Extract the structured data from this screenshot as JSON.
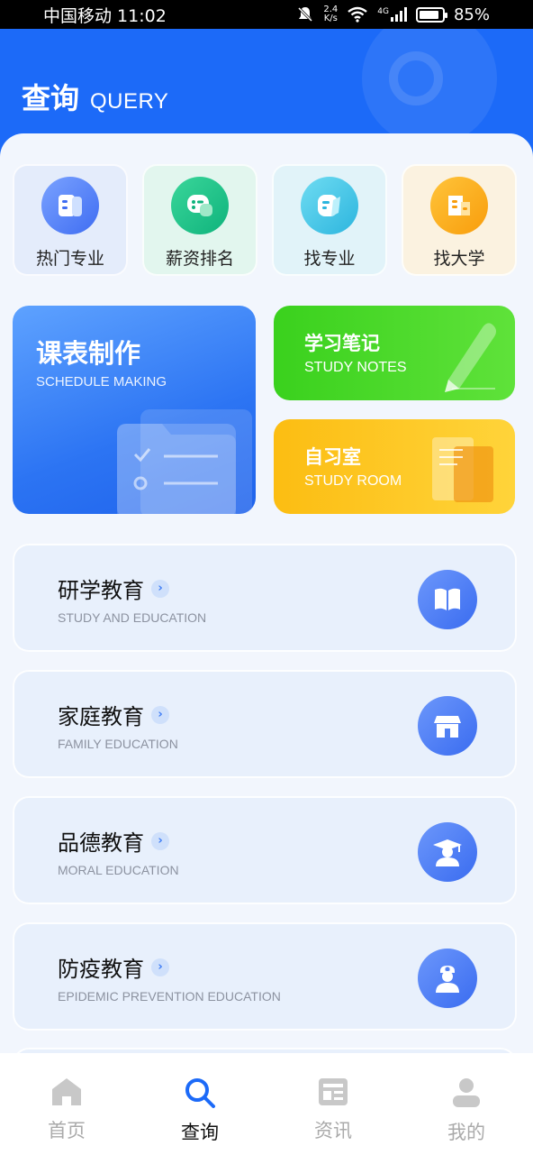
{
  "status_bar": {
    "carrier_time": "中国移动 11:02",
    "speed_value": "2.4",
    "speed_unit": "K/s",
    "network": "4G",
    "battery": "85%"
  },
  "header": {
    "title_zh": "查询",
    "title_en": "QUERY"
  },
  "quick_entries": [
    {
      "label": "热门专业",
      "icon": "book-stack-icon",
      "color": "#3f6df2"
    },
    {
      "label": "薪资排名",
      "icon": "chat-bubble-icon",
      "color": "#0fb37c"
    },
    {
      "label": "找专业",
      "icon": "note-icon",
      "color": "#2cb5de"
    },
    {
      "label": "找大学",
      "icon": "building-icon",
      "color": "#f89d0c"
    }
  ],
  "feature_cards": {
    "schedule": {
      "title": "课表制作",
      "subtitle": "SCHEDULE MAKING"
    },
    "notes": {
      "title": "学习笔记",
      "subtitle": "STUDY NOTES"
    },
    "room": {
      "title": "自习室",
      "subtitle": "STUDY ROOM"
    }
  },
  "education_list": [
    {
      "title": "研学教育",
      "subtitle": "STUDY AND EDUCATION",
      "icon": "open-book-icon"
    },
    {
      "title": "家庭教育",
      "subtitle": "FAMILY EDUCATION",
      "icon": "house-icon"
    },
    {
      "title": "品德教育",
      "subtitle": "MORAL EDUCATION",
      "icon": "graduate-icon"
    },
    {
      "title": "防疫教育",
      "subtitle": "EPIDEMIC PREVENTION EDUCATION",
      "icon": "doctor-icon"
    }
  ],
  "bottom_nav": [
    {
      "label": "首页",
      "icon": "home-icon",
      "active": false
    },
    {
      "label": "查询",
      "icon": "search-icon",
      "active": true
    },
    {
      "label": "资讯",
      "icon": "news-icon",
      "active": false
    },
    {
      "label": "我的",
      "icon": "user-icon",
      "active": false
    }
  ],
  "colors": {
    "primary": "#1c6af8",
    "active_nav": "#1c6af8",
    "inactive_nav": "#c8c8c8"
  }
}
